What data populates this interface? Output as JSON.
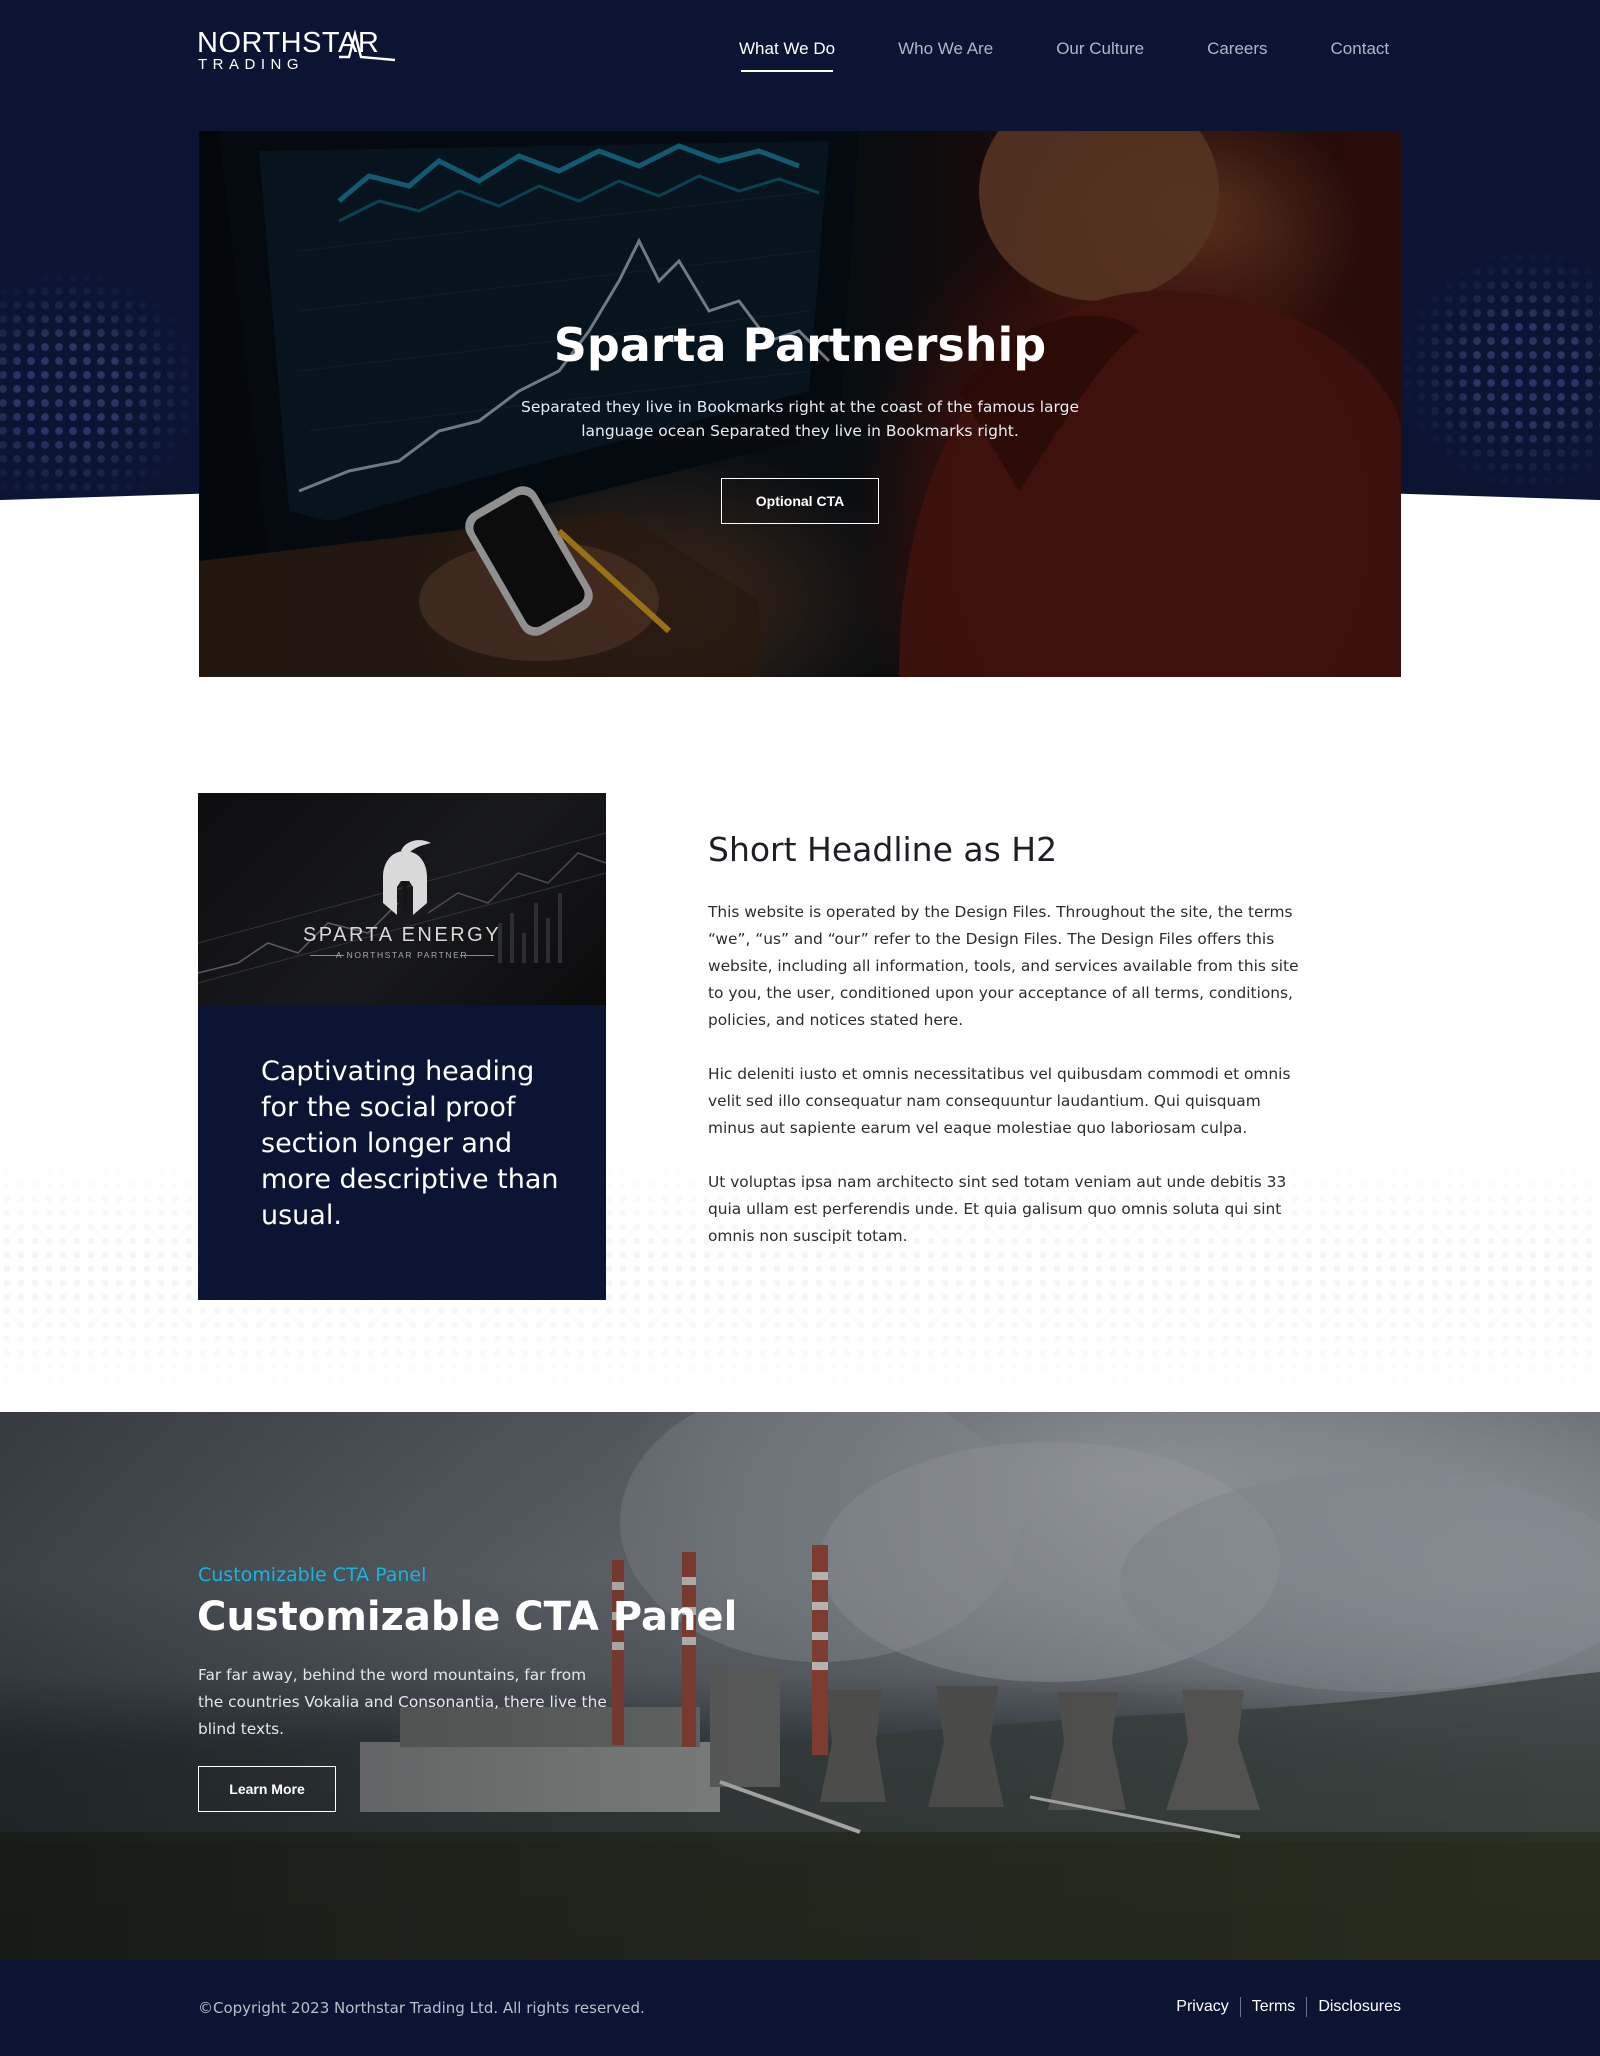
{
  "header": {
    "logo": {
      "top": "NORTHSTAR",
      "bottom": "TRADING"
    },
    "nav": [
      {
        "label": "What We Do",
        "active": true
      },
      {
        "label": "Who We Are",
        "active": false
      },
      {
        "label": "Our Culture",
        "active": false
      },
      {
        "label": "Careers",
        "active": false
      },
      {
        "label": "Contact",
        "active": false
      }
    ]
  },
  "hero": {
    "title": "Sparta Partnership",
    "text": "Separated they live in Bookmarks right at the coast of the famous large language ocean Separated they live in Bookmarks right.",
    "cta_label": "Optional CTA"
  },
  "about": {
    "brand": {
      "name": "SPARTA ENERGY",
      "tagline": "A NORTHSTAR PARTNER"
    },
    "quote": "Captivating heading for the social proof section longer and more descriptive than usual.",
    "heading": "Short Headline as H2",
    "paragraphs": [
      "This website is operated by the Design Files. Throughout the site, the terms “we”, “us” and “our” refer to the Design Files. The Design Files offers this website, including all information, tools, and services available from this site to you, the user, conditioned upon your acceptance of all terms, conditions, policies, and notices stated here.",
      "Hic deleniti iusto et omnis necessitatibus vel quibusdam commodi et omnis velit sed illo consequatur nam consequuntur laudantium. Qui quisquam minus aut sapiente earum vel eaque molestiae quo laboriosam culpa.",
      "Ut voluptas ipsa nam architecto sint sed totam veniam aut unde debitis 33 quia ullam est perferendis unde. Et quia galisum quo omnis soluta qui sint omnis non suscipit totam."
    ]
  },
  "cta": {
    "eyebrow": "Customizable CTA Panel",
    "title": "Customizable CTA Panel",
    "text": "Far far away, behind the word mountains, far from the countries Vokalia and Consonantia, there live the blind texts.",
    "button_label": "Learn More"
  },
  "footer": {
    "copyright": "©Copyright 2023 Northstar Trading Ltd. All rights reserved.",
    "links": [
      "Privacy",
      "Terms",
      "Disclosures"
    ]
  },
  "colors": {
    "navy": "#0b1533",
    "accent": "#16b5e0",
    "white": "#ffffff"
  }
}
